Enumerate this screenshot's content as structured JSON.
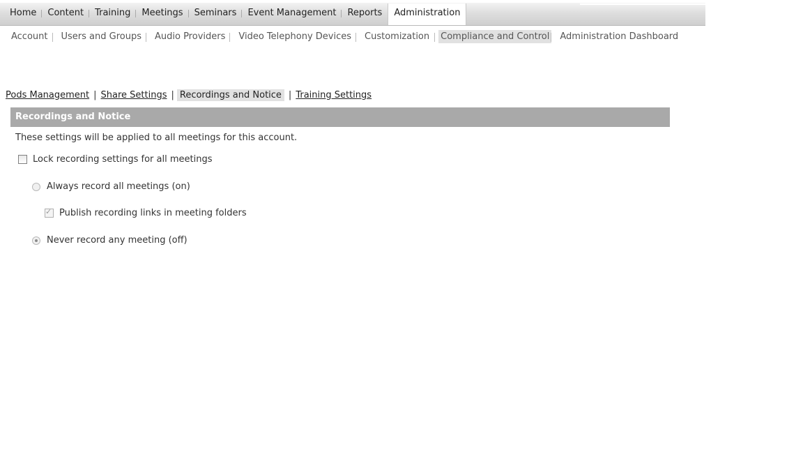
{
  "top_nav": {
    "tabs": [
      {
        "label": "Home"
      },
      {
        "label": "Content"
      },
      {
        "label": "Training"
      },
      {
        "label": "Meetings"
      },
      {
        "label": "Seminars"
      },
      {
        "label": "Event Management"
      },
      {
        "label": "Reports"
      },
      {
        "label": "Administration"
      }
    ],
    "active": "Administration"
  },
  "sub_nav": {
    "items": [
      {
        "label": "Account"
      },
      {
        "label": "Users and Groups"
      },
      {
        "label": "Audio Providers"
      },
      {
        "label": "Video Telephony Devices"
      },
      {
        "label": "Customization"
      },
      {
        "label": "Compliance and Control"
      },
      {
        "label": "Administration Dashboard"
      }
    ],
    "active": "Compliance and Control"
  },
  "section_links": {
    "items": [
      {
        "label": "Pods Management"
      },
      {
        "label": "Share Settings"
      },
      {
        "label": "Recordings and Notice"
      },
      {
        "label": "Training Settings"
      }
    ],
    "active": "Recordings and Notice",
    "separator": "|"
  },
  "panel": {
    "title": "Recordings and Notice",
    "description": "These settings will be applied to all meetings for this account.",
    "lock_checkbox": {
      "label": "Lock recording settings for all meetings",
      "checked": false
    },
    "always_record_radio": {
      "label": "Always record all meetings (on)",
      "selected": false
    },
    "publish_checkbox": {
      "label": "Publish recording links in meeting folders",
      "checked": true
    },
    "never_record_radio": {
      "label": "Never record any meeting (off)",
      "selected": true
    }
  }
}
